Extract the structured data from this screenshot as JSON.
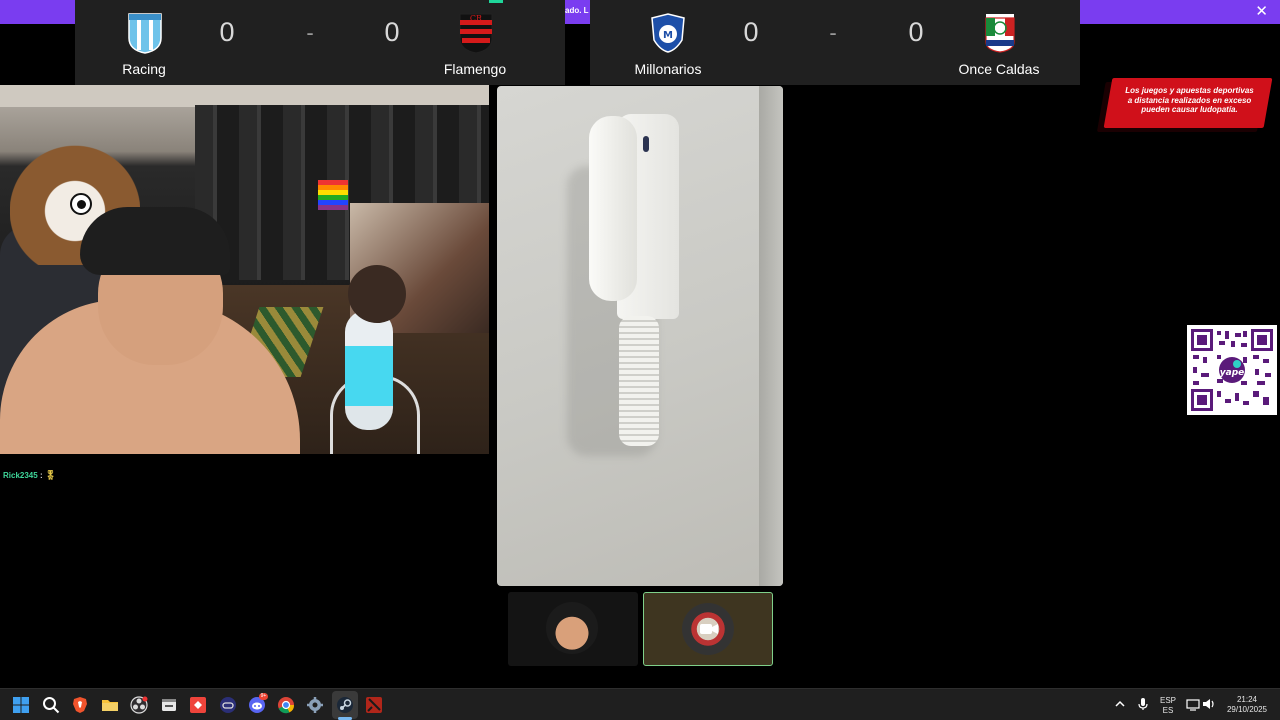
{
  "banner": {
    "ticker_text": "ado. L",
    "close_label": "✕"
  },
  "scoreboards": [
    {
      "home": {
        "name": "Racing",
        "score": "0"
      },
      "separator": "-",
      "away": {
        "name": "Flamengo",
        "score": "0"
      }
    },
    {
      "home": {
        "name": "Millonarios",
        "score": "0"
      },
      "separator": "-",
      "away": {
        "name": "Once Caldas",
        "score": "0"
      }
    }
  ],
  "chat": {
    "username": "Rick2345",
    "separator": ":",
    "message": "🎖"
  },
  "warning": {
    "line1": "Los juegos y apuestas deportivas",
    "line2": "a distancia realizados en exceso",
    "line3": "pueden causar ludopatía."
  },
  "qr": {
    "brand": "yape"
  },
  "taskbar": {
    "apps": [
      "windows-start",
      "search",
      "brave",
      "file-explorer",
      "obs",
      "media-app",
      "anydesk",
      "disc-app",
      "discord",
      "chrome",
      "settings",
      "steam",
      "dota"
    ],
    "discord_badge": "9+",
    "language_top": "ESP",
    "language_bottom": "ES",
    "time": "21:24",
    "date": "29/10/2025"
  },
  "colors": {
    "banner": "#7a3df0",
    "scoreboard_bg": "#202020",
    "warning_red": "#d0101a",
    "chat_user": "#3fd69a",
    "active_tile_border": "#7fd08a"
  }
}
